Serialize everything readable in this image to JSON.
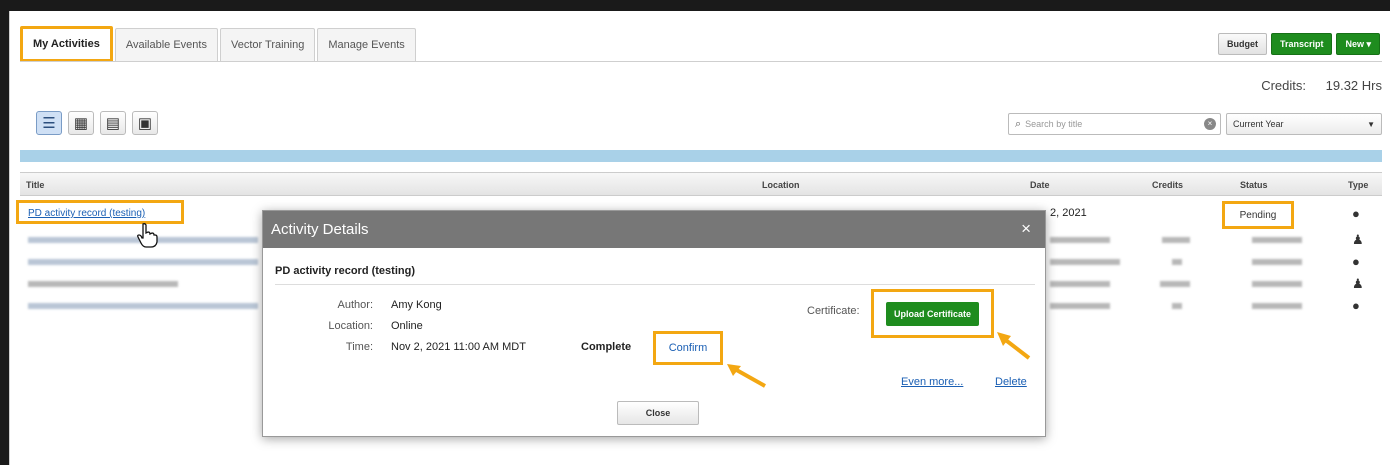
{
  "tabs": [
    {
      "label": "My Activities",
      "active": true
    },
    {
      "label": "Available Events",
      "active": false
    },
    {
      "label": "Vector Training",
      "active": false
    },
    {
      "label": "Manage Events",
      "active": false
    }
  ],
  "top_buttons": {
    "budget": "Budget",
    "transcript": "Transcript",
    "new": "New ▾"
  },
  "credits": {
    "label": "Credits:",
    "value": "19.32 Hrs"
  },
  "view_icons": [
    "list-view-icon",
    "calendar-month-icon",
    "calendar-week-icon",
    "calendar-day-icon"
  ],
  "search": {
    "placeholder": "Search by title"
  },
  "filter": {
    "selected": "Current Year"
  },
  "table": {
    "headers": {
      "title": "Title",
      "location": "Location",
      "date": "Date",
      "credits": "Credits",
      "status": "Status",
      "type": "Type"
    },
    "first_row": {
      "title": "PD activity record (testing)",
      "date": "2, 2021",
      "status": "Pending"
    }
  },
  "modal": {
    "title": "Activity Details",
    "close_glyph": "×",
    "activity": "PD activity record (testing)",
    "author_label": "Author:",
    "author": "Amy Kong",
    "location_label": "Location:",
    "location": "Online",
    "time_label": "Time:",
    "time": "Nov 2, 2021 11:00 AM MDT",
    "status": "Complete",
    "confirm": "Confirm",
    "certificate_label": "Certificate:",
    "upload": "Upload Certificate",
    "even_more": "Even more...",
    "delete": "Delete",
    "close": "Close"
  },
  "colors": {
    "highlight": "#f3a712",
    "green": "#1e8c1e",
    "link": "#1a5fb4",
    "band": "#a9d1e8"
  }
}
